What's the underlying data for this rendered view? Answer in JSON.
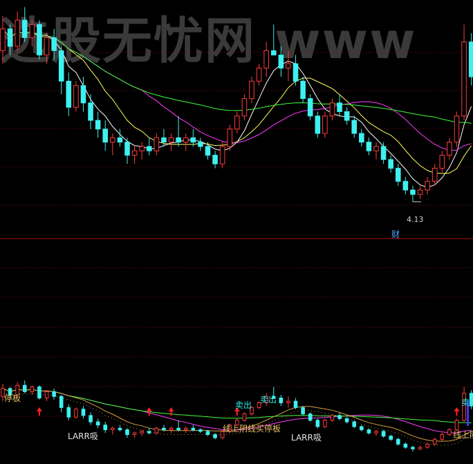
{
  "watermark": "选股无忧网 www",
  "annotations": {
    "low_price": "4.13",
    "cai_badge": "财",
    "larr_1": "LARR吸",
    "larr_2": "LARR吸",
    "yang_line": "线上阴线买停板",
    "sell_1": "卖出",
    "sell_2": "卖出",
    "top_left": "停板",
    "right_edge": "线上阴",
    "sell_3": "卖出"
  },
  "colors": {
    "up": "#ff3c3c",
    "down": "#3ff0f0",
    "ma_short": "#ffffff",
    "ma_mid": "#ffff5a",
    "ma_long": "#ff3cff",
    "ma_longest": "#3cff3c",
    "panel_divider": "#b01010",
    "grid": "#8a1010",
    "arrow": "#ff2020",
    "gold_line": "#d8a040"
  },
  "chart_data": {
    "type": "candlestick",
    "title": "",
    "xlabel": "",
    "ylabel": "",
    "bars": [
      [
        7.6,
        8.4,
        7.3,
        8.1
      ],
      [
        8.1,
        8.2,
        7.5,
        7.7
      ],
      [
        7.7,
        8.5,
        7.6,
        8.3
      ],
      [
        8.3,
        8.6,
        7.8,
        7.9
      ],
      [
        7.9,
        8.3,
        7.7,
        8.2
      ],
      [
        8.2,
        8.3,
        7.4,
        7.5
      ],
      [
        7.5,
        8.0,
        7.3,
        7.9
      ],
      [
        7.9,
        8.1,
        7.4,
        7.6
      ],
      [
        7.6,
        7.7,
        6.6,
        6.9
      ],
      [
        6.9,
        7.1,
        6.1,
        6.3
      ],
      [
        6.3,
        6.9,
        6.2,
        6.8
      ],
      [
        6.8,
        7.0,
        6.2,
        6.4
      ],
      [
        6.4,
        6.6,
        5.8,
        6.0
      ],
      [
        6.0,
        6.2,
        5.6,
        5.8
      ],
      [
        5.8,
        6.0,
        5.3,
        5.5
      ],
      [
        5.5,
        5.7,
        5.2,
        5.6
      ],
      [
        5.6,
        5.8,
        5.4,
        5.5
      ],
      [
        5.5,
        5.6,
        5.0,
        5.2
      ],
      [
        5.2,
        5.4,
        5.0,
        5.3
      ],
      [
        5.3,
        5.5,
        5.1,
        5.4
      ],
      [
        5.4,
        5.6,
        5.2,
        5.3
      ],
      [
        5.3,
        5.7,
        5.2,
        5.6
      ],
      [
        5.6,
        5.8,
        5.4,
        5.5
      ],
      [
        5.5,
        5.7,
        5.3,
        5.6
      ],
      [
        5.6,
        6.1,
        5.4,
        5.5
      ],
      [
        5.5,
        5.7,
        5.3,
        5.6
      ],
      [
        5.6,
        5.8,
        5.4,
        5.5
      ],
      [
        5.5,
        5.6,
        5.3,
        5.4
      ],
      [
        5.4,
        5.5,
        5.1,
        5.2
      ],
      [
        5.2,
        5.3,
        4.9,
        5.0
      ],
      [
        5.0,
        5.5,
        4.9,
        5.4
      ],
      [
        5.4,
        5.9,
        5.3,
        5.8
      ],
      [
        5.8,
        6.2,
        5.7,
        6.1
      ],
      [
        6.1,
        6.6,
        6.0,
        6.5
      ],
      [
        6.5,
        7.0,
        6.4,
        6.9
      ],
      [
        6.9,
        7.3,
        6.8,
        7.2
      ],
      [
        7.2,
        7.8,
        7.0,
        7.6
      ],
      [
        7.6,
        8.2,
        7.5,
        7.5
      ],
      [
        7.5,
        7.7,
        7.0,
        7.2
      ],
      [
        7.2,
        7.6,
        6.9,
        7.3
      ],
      [
        7.3,
        7.5,
        6.8,
        6.9
      ],
      [
        6.9,
        7.0,
        6.4,
        6.5
      ],
      [
        6.5,
        6.6,
        6.0,
        6.1
      ],
      [
        6.1,
        6.2,
        5.6,
        5.7
      ],
      [
        5.7,
        6.2,
        5.6,
        6.1
      ],
      [
        6.1,
        6.5,
        6.0,
        6.4
      ],
      [
        6.4,
        6.6,
        6.1,
        6.2
      ],
      [
        6.2,
        6.3,
        5.9,
        6.0
      ],
      [
        6.0,
        6.1,
        5.6,
        5.7
      ],
      [
        5.7,
        5.8,
        5.4,
        5.5
      ],
      [
        5.5,
        5.6,
        5.2,
        5.3
      ],
      [
        5.3,
        5.5,
        5.1,
        5.4
      ],
      [
        5.4,
        5.5,
        5.0,
        5.1
      ],
      [
        5.1,
        5.2,
        4.8,
        4.9
      ],
      [
        4.9,
        5.0,
        4.5,
        4.6
      ],
      [
        4.6,
        4.7,
        4.3,
        4.4
      ],
      [
        4.4,
        4.5,
        4.13,
        4.3
      ],
      [
        4.3,
        4.5,
        4.2,
        4.4
      ],
      [
        4.4,
        4.7,
        4.3,
        4.6
      ],
      [
        4.6,
        5.0,
        4.5,
        4.9
      ],
      [
        4.9,
        5.3,
        4.8,
        5.2
      ],
      [
        5.2,
        5.6,
        5.1,
        5.5
      ],
      [
        5.5,
        6.2,
        5.4,
        6.1
      ],
      [
        6.1,
        8.2,
        6.0,
        7.8
      ],
      [
        7.8,
        8.0,
        6.8,
        7.0
      ]
    ]
  }
}
